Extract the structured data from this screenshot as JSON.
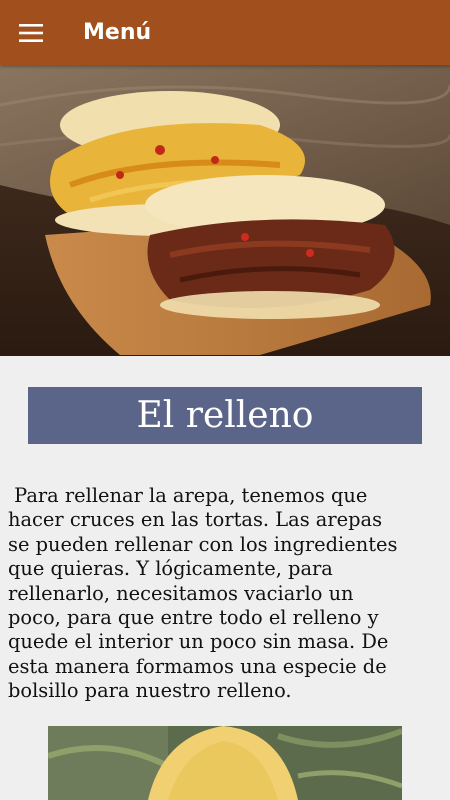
{
  "appbar": {
    "title": "Menú",
    "menu_icon": "hamburger-menu-icon"
  },
  "section": {
    "title": "El relleno",
    "paragraph": " Para rellenar la arepa, tenemos que\nhacer cruces en las tortas. Las arepas\nse pueden rellenar con los ingredientes\nque quieras. Y lógicamente, para\nrellenarlo, necesitamos vaciarlo un\npoco, para que entre todo el relleno y\nquede el interior un poco sin masa. De\nesta manera formamos una especie de\nbolsillo para nuestro relleno."
  },
  "colors": {
    "appbar": "#a14f1c",
    "title_bar": "#5b6589",
    "background": "#efefef"
  }
}
